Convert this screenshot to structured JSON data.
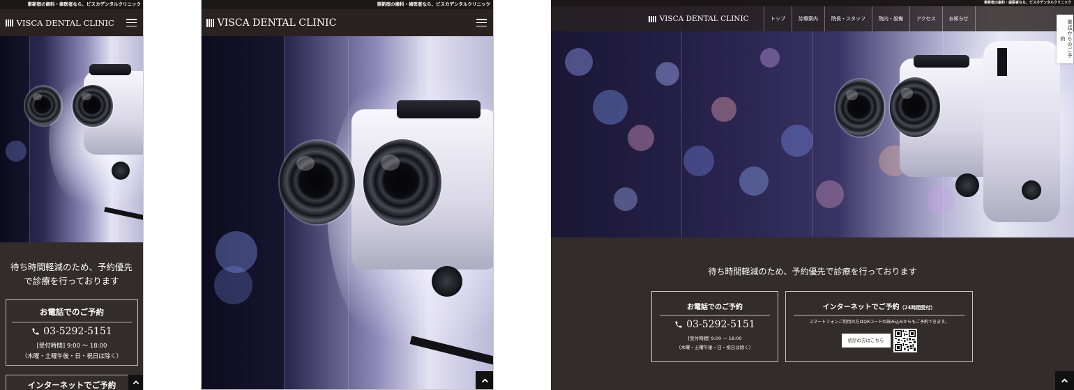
{
  "site": {
    "tagline": "東新宿の歯科・歯医者なら、ビスカデンタルクリニック",
    "logo_text": "VISCA DENTAL CLINIC"
  },
  "nav": {
    "items": [
      "トップ",
      "診療案内",
      "院長・スタッフ",
      "院内・設備",
      "アクセス",
      "お知らせ"
    ]
  },
  "side_reserve_label": "電話からのご予約",
  "reservation": {
    "priority_note": "待ち時間軽減のため、予約優先で診療を行っております",
    "phone": {
      "title": "お電話でのご予約",
      "number": "03-5292-5151",
      "hours": "[受付時間] 9:00 〜 18:00",
      "closed": "（木曜・土曜午後・日・祝日は除く）"
    },
    "internet": {
      "title": "インターネットでご予約",
      "title_suffix": "（24時間受付）",
      "description": "スマートフォンご利用の方はQRコードの読み込みからもご予約できます。",
      "first_visit_button": "初診の方はこちら"
    }
  },
  "colors": {
    "dark_bg": "#322c2a",
    "topbar_bg": "#1c1817",
    "border": "#c9c3c0"
  },
  "icons": {
    "phone": "phone-icon",
    "menu": "hamburger-icon",
    "pagetop": "chevron-up-icon",
    "qr": "qr-code-icon"
  }
}
